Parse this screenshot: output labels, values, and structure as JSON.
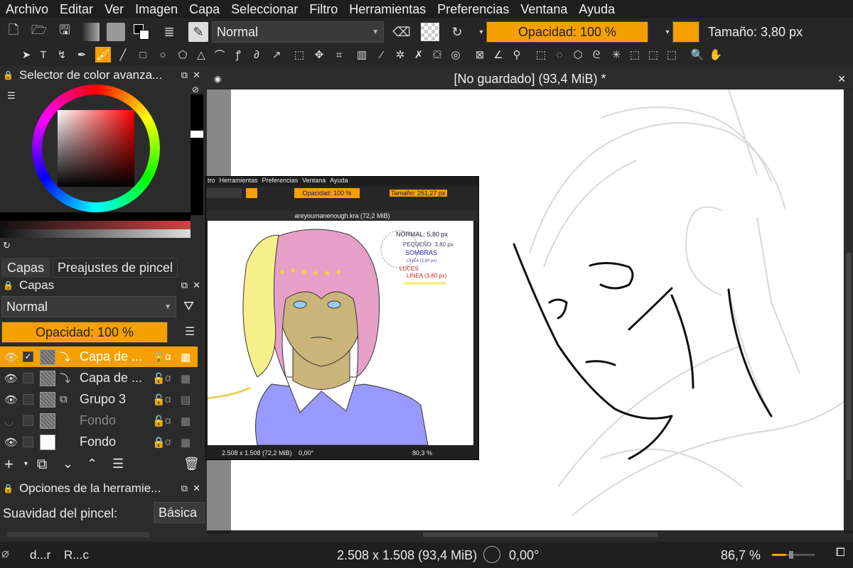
{
  "menu": [
    "Archivo",
    "Editar",
    "Ver",
    "Imagen",
    "Capa",
    "Seleccionar",
    "Filtro",
    "Herramientas",
    "Preferencias",
    "Ventana",
    "Ayuda"
  ],
  "toolbar": {
    "blend_mode": "Normal",
    "opacity": "Opacidad: 100 %",
    "size": "Tamaño: 3,80 px"
  },
  "color_selector": {
    "title": "Selector de color avanza..."
  },
  "dock_tabs": {
    "layers_tab": "Capas",
    "presets_tab": "Preajustes de pincel"
  },
  "layers": {
    "title": "Capas",
    "blend_mode": "Normal",
    "opacity": "Opacidad:  100 %",
    "items": [
      {
        "name": "Capa de ...",
        "selected": true
      },
      {
        "name": "Capa de ...",
        "selected": false
      },
      {
        "name": "Grupo 3",
        "selected": false
      },
      {
        "name": "Fondo",
        "selected": false,
        "hidden": true
      },
      {
        "name": "Fondo",
        "selected": false
      }
    ]
  },
  "tool_options": {
    "title": "Opciones de la herramie...",
    "smoothing_label": "Suavidad del pincel:",
    "smoothing_value": "Básica"
  },
  "document": {
    "title": "[No guardado]  (93,4 MiB) *"
  },
  "inner_window": {
    "menu": [
      "tro",
      "Herramientas",
      "Preferencias",
      "Ventana",
      "Ayuda"
    ],
    "opacity": "Opacidad: 100 %",
    "size": "Tamaño: 251,27 px",
    "doc_title": "areyoumanenough.kra (72,2 MiB)",
    "status_size": "2.508 x 1.508 (72,2 MiB)",
    "status_rot": "0,00°",
    "status_zoom": "80,3 %",
    "notes": [
      "NORMAL: 5,80 px",
      "PEQUEÑO: 3,80 px",
      "SOMBRAS",
      "LÍNEA (3,80 px)",
      "LUCES",
      "LÍNEA (3,80 px)"
    ]
  },
  "status": {
    "brush": "d...r",
    "pattern": "R...c",
    "dimensions": "2.508 x 1.508 (93,4 MiB)",
    "rotation": "0,00°",
    "zoom": "86,7 %"
  },
  "colors": {
    "accent": "#f5a000",
    "bg": "#2a2a2a"
  }
}
